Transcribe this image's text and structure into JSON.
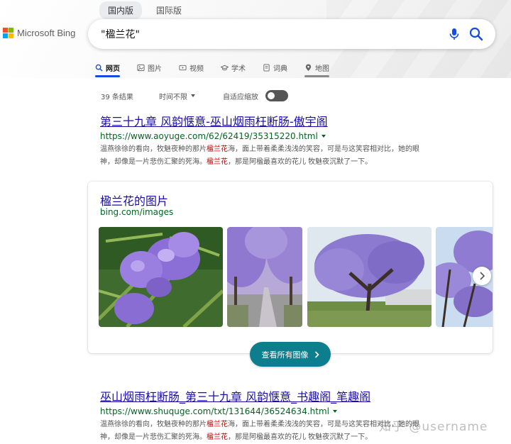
{
  "region_tabs": [
    "国内版",
    "国际版"
  ],
  "logo": {
    "text": "Microsoft Bing"
  },
  "search": {
    "value": "\"楹兰花\""
  },
  "nav": [
    {
      "label": "网页",
      "icon": "search-icon"
    },
    {
      "label": "图片",
      "icon": "image-icon"
    },
    {
      "label": "视频",
      "icon": "video-icon"
    },
    {
      "label": "学术",
      "icon": "academic-cap-icon"
    },
    {
      "label": "词典",
      "icon": "dictionary-icon"
    },
    {
      "label": "地图",
      "icon": "map-pin-icon"
    }
  ],
  "tools": {
    "count": "39 条结果",
    "time": "时间不限",
    "zoom_label": "自适应缩放",
    "zoom_on": false
  },
  "results": [
    {
      "title": "第三十九章 风韵惬意-巫山烟雨枉断肠-傲宇阁",
      "url": "https://www.aoyuge.com/62/62419/35315220.html",
      "snippet_line1": [
        "温燕徐徐的看向，牧魅夜种的那片",
        "楹兰花",
        "海，面上带着柔柔浅浅的笑容，可是与这笑容相对比，她的眼"
      ],
      "snippet_line2": [
        "神，却像是一片悲伤汇聚的死海。",
        "楹兰花",
        "，那是阿楹最喜欢的花儿 牧魅夜沉默了一下。"
      ]
    },
    {
      "title": "巫山烟雨枉断肠_第三十九章 风韵惬意_书趣阁_笔趣阁",
      "url": "https://www.shuquge.com/txt/131644/36524634.html",
      "snippet_line1": [
        "温燕徐徐的看向，牧魅夜种的那片",
        "楹兰花",
        "海，面上带着柔柔浅浅的笑容，可是与这笑容相对比，她的眼"
      ],
      "snippet_line2": [
        "神，却像是一片悲伤汇聚的死海。",
        "楹兰花",
        "，那是阿楹最喜欢的花儿 牧魅夜沉默了一下。"
      ]
    }
  ],
  "images": {
    "title": "楹兰花的图片",
    "source": "bing.com/images",
    "see_all": "查看所有图像"
  },
  "watermark": "知乎 @username",
  "colors": {
    "link": "#1a0dab",
    "url": "#006621",
    "accent": "#174ae4",
    "button": "#0c7e8e",
    "highlight": "#cc0000"
  }
}
